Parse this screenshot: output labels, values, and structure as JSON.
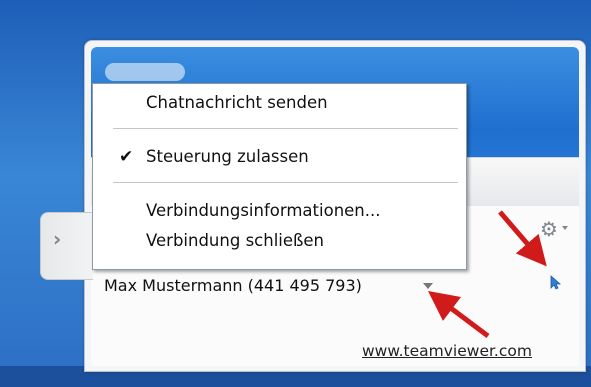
{
  "menu": {
    "items": [
      {
        "label": "Chatnachricht senden",
        "checked": false
      },
      {
        "label": "Steuerung zulassen",
        "checked": true
      },
      {
        "label": "Verbindungsinformationen...",
        "checked": false
      },
      {
        "label": "Verbindung schließen",
        "checked": false
      }
    ]
  },
  "connection": {
    "name": "Max Mustermann (441 495 793)"
  },
  "footer": {
    "url": "www.teamviewer.com"
  },
  "icons": {
    "tab_more": "double-chevron-right-icon",
    "side_tab": "chevron-right-icon",
    "settings": "gear-icon",
    "pointer": "cursor-icon",
    "check": "checkmark-icon"
  },
  "colors": {
    "header_blue": "#1f6fd0",
    "annotation_red": "#d11a1a"
  }
}
